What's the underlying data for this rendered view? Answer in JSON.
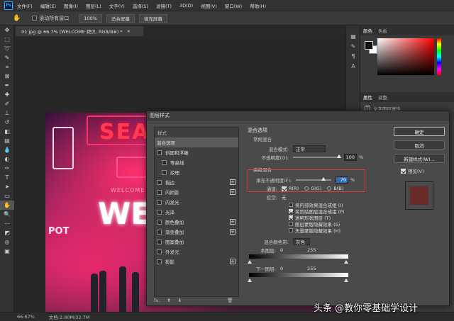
{
  "menubar": {
    "logo": "Ps",
    "items": [
      "文件(F)",
      "编辑(E)",
      "图像(I)",
      "图层(L)",
      "文字(Y)",
      "选择(S)",
      "滤镜(T)",
      "3D(D)",
      "视图(V)",
      "窗口(W)",
      "帮助(H)"
    ]
  },
  "options": {
    "hand_icon": "hand-icon",
    "scroll_all_label": "滚动所有窗口",
    "zoom_100": "100%",
    "fit_screen": "适合屏幕",
    "fill_screen": "填充屏幕"
  },
  "document": {
    "tab_title": "01.jpg @ 66.7% (WELCOME 拷贝, RGB/8#) *",
    "tab_close": "×",
    "art_text_sea_zone": "SEA ZONE",
    "art_text_welcome_small": "WELCOME TO S",
    "art_text_we": "WE",
    "art_text_pot": "POT"
  },
  "right_panel": {
    "tabs": [
      "颜色",
      "色板"
    ],
    "props_tabs": [
      "属性",
      "调整"
    ],
    "props_title": "文字图层属性"
  },
  "status": {
    "zoom": "66.67%",
    "doc": "文档:2.80M/32.7M"
  },
  "watermark": "头条 @教你零基础学设计",
  "dialog": {
    "title": "图层样式",
    "left_header": "样式",
    "styles": [
      {
        "label": "混合选项",
        "selected": true,
        "checkbox": false,
        "plus": false,
        "sub": false
      },
      {
        "label": "斜面和浮雕",
        "checkbox": true,
        "plus": false,
        "sub": false
      },
      {
        "label": "等高线",
        "checkbox": true,
        "plus": false,
        "sub": true
      },
      {
        "label": "纹理",
        "checkbox": true,
        "plus": false,
        "sub": true
      },
      {
        "label": "描边",
        "checkbox": true,
        "plus": true,
        "sub": false
      },
      {
        "label": "内阴影",
        "checkbox": true,
        "plus": true,
        "sub": false
      },
      {
        "label": "内发光",
        "checkbox": true,
        "plus": false,
        "sub": false
      },
      {
        "label": "光泽",
        "checkbox": true,
        "plus": false,
        "sub": false
      },
      {
        "label": "颜色叠加",
        "checkbox": true,
        "plus": true,
        "sub": false
      },
      {
        "label": "渐变叠加",
        "checkbox": true,
        "plus": true,
        "sub": false
      },
      {
        "label": "图案叠加",
        "checkbox": true,
        "plus": false,
        "sub": false
      },
      {
        "label": "外发光",
        "checkbox": true,
        "plus": false,
        "sub": false
      },
      {
        "label": "投影",
        "checkbox": true,
        "plus": true,
        "sub": false
      }
    ],
    "footer_fx": "fx.",
    "blend": {
      "section_title": "混合选项",
      "general_title": "常规混合",
      "mode_label": "混合模式:",
      "mode_value": "正常",
      "opacity_label": "不透明度(O):",
      "opacity_value": "100",
      "percent": "%",
      "advanced_title": "高级混合",
      "fill_label": "填充不透明度(F):",
      "fill_value": "79",
      "fill_percent": "%",
      "channels_label": "通道:",
      "channel_r": "R(R)",
      "channel_g": "G(G)",
      "channel_b": "B(B)",
      "knockout_label": "挖空:",
      "knockout_value": "无",
      "options": [
        {
          "label": "将内部效果混合成组 (I)",
          "checked": false
        },
        {
          "label": "将剪贴图层混合成组 (P)",
          "checked": true
        },
        {
          "label": "透明形状图层 (T)",
          "checked": true
        },
        {
          "label": "图层蒙版隐藏效果 (S)",
          "checked": false
        },
        {
          "label": "矢量蒙版隐藏效果 (H)",
          "checked": false
        }
      ],
      "blend_if_label": "混合颜色带:",
      "blend_if_value": "灰色",
      "this_layer_label": "本图层:",
      "this_layer_low": "0",
      "this_layer_high": "255",
      "under_layer_label": "下一图层:",
      "under_layer_low": "0",
      "under_layer_high": "255"
    },
    "buttons": {
      "ok": "确定",
      "cancel": "取消",
      "new_style": "新建样式(W)...",
      "preview": "预览(V)"
    }
  }
}
